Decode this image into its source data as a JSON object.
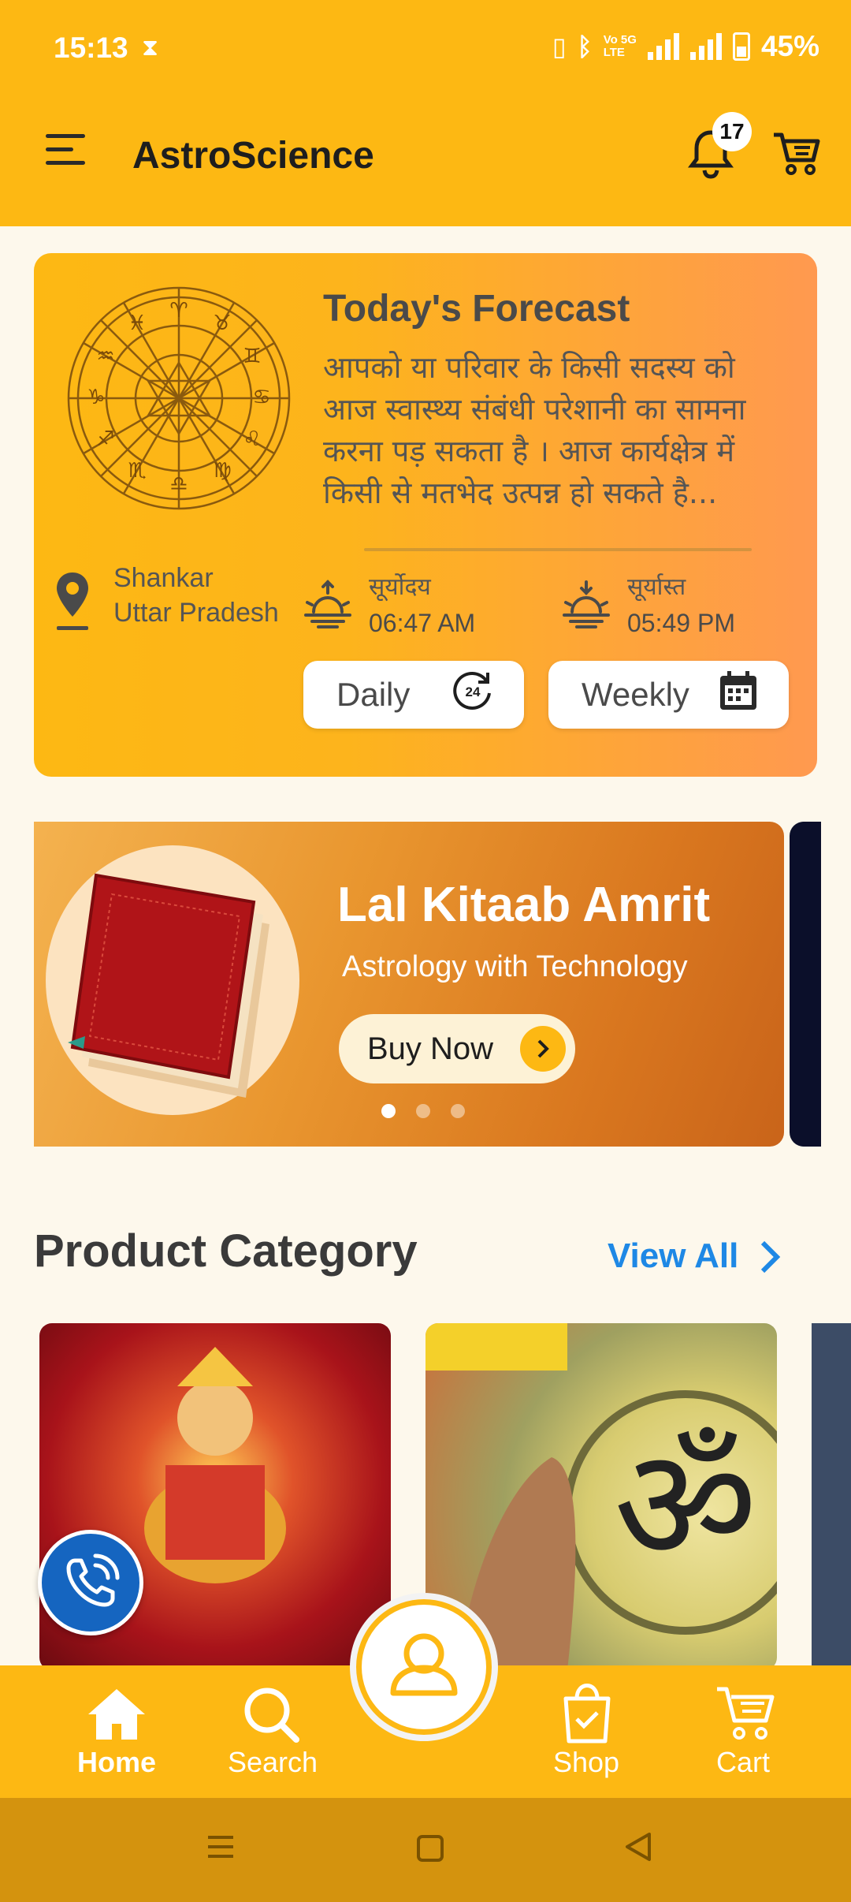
{
  "status_bar": {
    "time": "15:13",
    "battery": "45%",
    "net1": "Vo 5G",
    "net2": "LTE"
  },
  "header": {
    "title": "AstroScience",
    "notification_count": "17"
  },
  "forecast": {
    "title": "Today's Forecast",
    "text": "आपको या परिवार के किसी सदस्य को आज स्वास्थ्य संबंधी परेशानी का सामना करना पड़ सकता है । आज कार्यक्षेत्र में किसी से मतभेद उत्पन्न हो सकते है...",
    "location_city": "Shankar",
    "location_state": "Uttar Pradesh",
    "sunrise_label": "सूर्योदय",
    "sunrise_time": "06:47 AM",
    "sunset_label": "सूर्यास्त",
    "sunset_time": "05:49 PM",
    "daily_label": "Daily",
    "weekly_label": "Weekly"
  },
  "banner": {
    "title": "Lal Kitaab Amrit",
    "subtitle": "Astrology with Technology",
    "button_label": "Buy Now",
    "slide_count": 3,
    "active_slide": 1
  },
  "product_category": {
    "title": "Product Category",
    "view_all": "View All"
  },
  "bottom_nav": {
    "items": [
      {
        "label": "Home",
        "icon": "home-icon",
        "active": true
      },
      {
        "label": "Search",
        "icon": "search-icon",
        "active": false
      },
      {
        "label": "Shop",
        "icon": "shopping-bag-icon",
        "active": false
      },
      {
        "label": "Cart",
        "icon": "cart-icon",
        "active": false
      }
    ]
  },
  "colors": {
    "primary": "#FDB813",
    "link": "#1E88E5",
    "call_fab": "#1565C0"
  }
}
